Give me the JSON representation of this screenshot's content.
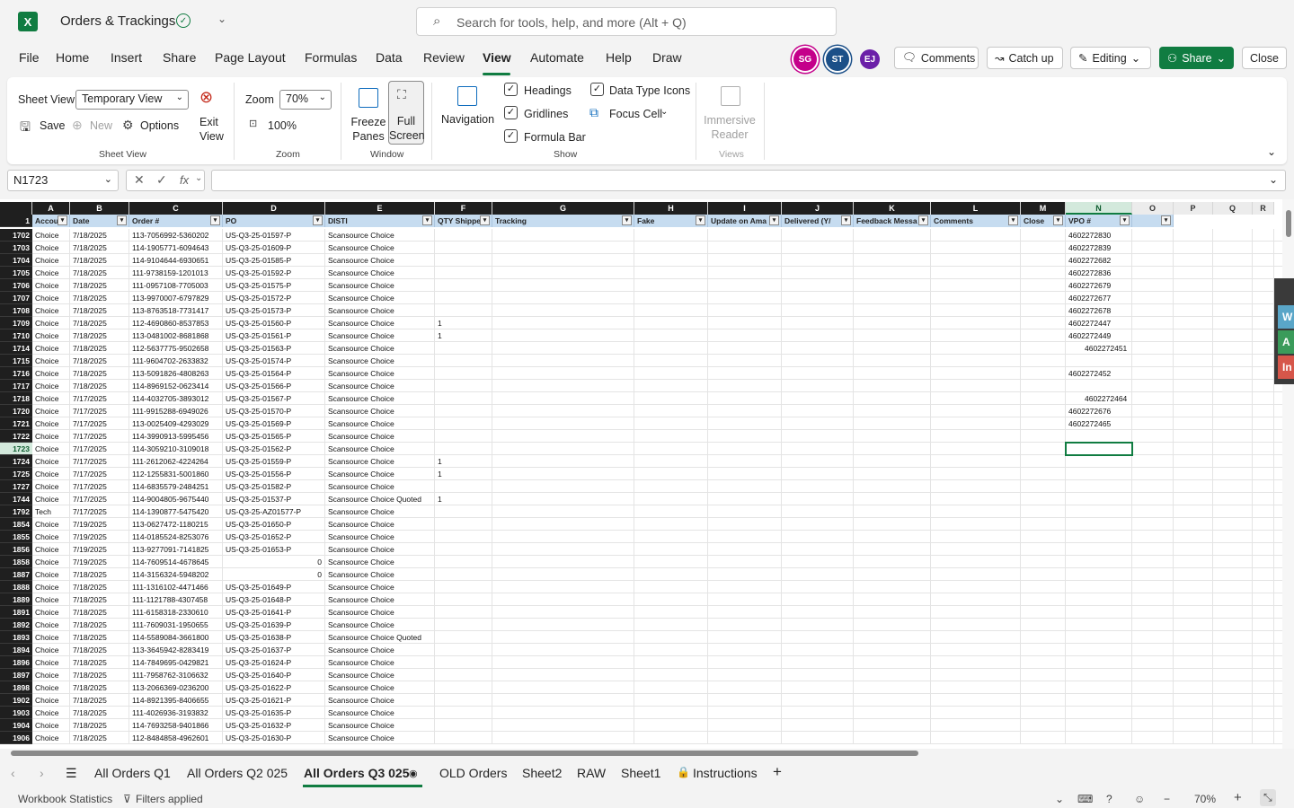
{
  "titlebar": {
    "logo": "X",
    "doc_title": "Orders & Trackings",
    "search_placeholder": "Search for tools, help, and more (Alt + Q)"
  },
  "menu": [
    "File",
    "Home",
    "Insert",
    "Share",
    "Page Layout",
    "Formulas",
    "Data",
    "Review",
    "View",
    "Automate",
    "Help",
    "Draw"
  ],
  "active_menu": "View",
  "avatars": [
    {
      "initials": "SG",
      "color": "#c4008a"
    },
    {
      "initials": "ST",
      "color": "#1b4f88"
    },
    {
      "initials": "EJ",
      "color": "#6b1fa8"
    }
  ],
  "top_buttons": {
    "comments": "Comments",
    "catchup": "Catch up",
    "editing": "Editing",
    "share": "Share",
    "close": "Close"
  },
  "ribbon": {
    "sheet_view_label": "Sheet View",
    "sheet_view_select": "Temporary View",
    "save": "Save",
    "new": "New",
    "options": "Options",
    "exit_view": "Exit View",
    "group_sheet_view": "Sheet View",
    "zoom_label": "Zoom",
    "zoom_value": "70%",
    "zoom_100": "100%",
    "group_zoom": "Zoom",
    "freeze_panes": "Freeze Panes",
    "full_screen": "Full Screen",
    "group_window": "Window",
    "navigation": "Navigation",
    "headings": "Headings",
    "gridlines": "Gridlines",
    "formula_bar": "Formula Bar",
    "data_type_icons": "Data Type Icons",
    "focus_cell": "Focus Cell",
    "group_show": "Show",
    "immersive_reader": "Immersive Reader",
    "group_views": "Views"
  },
  "formula_bar": {
    "name_box": "N1723",
    "fx": "fx",
    "value": ""
  },
  "columns": [
    "A",
    "B",
    "C",
    "D",
    "E",
    "F",
    "G",
    "H",
    "I",
    "J",
    "K",
    "L",
    "M",
    "N",
    "O",
    "P",
    "Q",
    "R"
  ],
  "headers": [
    "Accou",
    "Date",
    "Order #",
    "PO",
    "DISTI",
    "QTY Shippe",
    "Tracking",
    "Fake",
    "Update on Ama",
    "Delivered (Y/",
    "Feedback Messa",
    "Comments",
    "Close",
    "VPO #",
    ""
  ],
  "header_row_num": "1",
  "rows": [
    [
      "1702",
      "Choice",
      "7/18/2025",
      "113-7056992-5360202",
      "US-Q3-25-01597-P",
      "Scansource Choice",
      "",
      "4602272830"
    ],
    [
      "1703",
      "Choice",
      "7/18/2025",
      "114-1905771-6094643",
      "US-Q3-25-01609-P",
      "Scansource Choice",
      "",
      "4602272839"
    ],
    [
      "1704",
      "Choice",
      "7/18/2025",
      "114-9104644-6930651",
      "US-Q3-25-01585-P",
      "Scansource Choice",
      "",
      "4602272682"
    ],
    [
      "1705",
      "Choice",
      "7/18/2025",
      "111-9738159-1201013",
      "US-Q3-25-01592-P",
      "Scansource Choice",
      "",
      "4602272836"
    ],
    [
      "1706",
      "Choice",
      "7/18/2025",
      "111-0957108-7705003",
      "US-Q3-25-01575-P",
      "Scansource Choice",
      "",
      "4602272679"
    ],
    [
      "1707",
      "Choice",
      "7/18/2025",
      "113-9970007-6797829",
      "US-Q3-25-01572-P",
      "Scansource Choice",
      "",
      "4602272677"
    ],
    [
      "1708",
      "Choice",
      "7/18/2025",
      "113-8763518-7731417",
      "US-Q3-25-01573-P",
      "Scansource Choice",
      "",
      "4602272678"
    ],
    [
      "1709",
      "Choice",
      "7/18/2025",
      "112-4690860-8537853",
      "US-Q3-25-01560-P",
      "Scansource Choice",
      "1",
      "4602272447"
    ],
    [
      "1710",
      "Choice",
      "7/18/2025",
      "113-0481002-8681868",
      "US-Q3-25-01561-P",
      "Scansource Choice",
      "1",
      "4602272449"
    ],
    [
      "1714",
      "Choice",
      "7/18/2025",
      "112-5637775-9502658",
      "US-Q3-25-01563-P",
      "Scansource Choice",
      "",
      "4602272451"
    ],
    [
      "1715",
      "Choice",
      "7/18/2025",
      "111-9604702-2633832",
      "US-Q3-25-01574-P",
      "Scansource Choice",
      "",
      ""
    ],
    [
      "1716",
      "Choice",
      "7/18/2025",
      "113-5091826-4808263",
      "US-Q3-25-01564-P",
      "Scansource Choice",
      "",
      "4602272452"
    ],
    [
      "1717",
      "Choice",
      "7/18/2025",
      "114-8969152-0623414",
      "US-Q3-25-01566-P",
      "Scansource Choice",
      "",
      ""
    ],
    [
      "1718",
      "Choice",
      "7/17/2025",
      "114-4032705-3893012",
      "US-Q3-25-01567-P",
      "Scansource Choice",
      "",
      "4602272464"
    ],
    [
      "1720",
      "Choice",
      "7/17/2025",
      "111-9915288-6949026",
      "US-Q3-25-01570-P",
      "Scansource Choice",
      "",
      "4602272676"
    ],
    [
      "1721",
      "Choice",
      "7/17/2025",
      "113-0025409-4293029",
      "US-Q3-25-01569-P",
      "Scansource Choice",
      "",
      "4602272465"
    ],
    [
      "1722",
      "Choice",
      "7/17/2025",
      "114-3990913-5995456",
      "US-Q3-25-01565-P",
      "Scansource Choice",
      "",
      ""
    ],
    [
      "1723",
      "Choice",
      "7/17/2025",
      "114-3059210-3109018",
      "US-Q3-25-01562-P",
      "Scansource Choice",
      "",
      ""
    ],
    [
      "1724",
      "Choice",
      "7/17/2025",
      "111-2612062-4224264",
      "US-Q3-25-01559-P",
      "Scansource Choice",
      "1",
      ""
    ],
    [
      "1725",
      "Choice",
      "7/17/2025",
      "112-1255831-5001860",
      "US-Q3-25-01556-P",
      "Scansource Choice",
      "1",
      ""
    ],
    [
      "1727",
      "Choice",
      "7/17/2025",
      "114-6835579-2484251",
      "US-Q3-25-01582-P",
      "Scansource Choice",
      "",
      ""
    ],
    [
      "1744",
      "Choice",
      "7/17/2025",
      "114-9004805-9675440",
      "US-Q3-25-01537-P",
      "Scansource Choice Quoted",
      "1",
      ""
    ],
    [
      "1792",
      "Tech",
      "7/17/2025",
      "114-1390877-5475420",
      "US-Q3-25-AZ01577-P",
      "Scansource Choice",
      "",
      ""
    ],
    [
      "1854",
      "Choice",
      "7/19/2025",
      "113-0627472-1180215",
      "US-Q3-25-01650-P",
      "Scansource Choice",
      "",
      ""
    ],
    [
      "1855",
      "Choice",
      "7/19/2025",
      "114-0185524-8253076",
      "US-Q3-25-01652-P",
      "Scansource Choice",
      "",
      ""
    ],
    [
      "1856",
      "Choice",
      "7/19/2025",
      "113-9277091-7141825",
      "US-Q3-25-01653-P",
      "Scansource Choice",
      "",
      ""
    ],
    [
      "1858",
      "Choice",
      "7/19/2025",
      "114-7609514-4678645",
      "0",
      "Scansource Choice",
      "",
      ""
    ],
    [
      "1887",
      "Choice",
      "7/18/2025",
      "114-3156324-5948202",
      "0",
      "Scansource Choice",
      "",
      ""
    ],
    [
      "1888",
      "Choice",
      "7/18/2025",
      "111-1316102-4471466",
      "US-Q3-25-01649-P",
      "Scansource Choice",
      "",
      ""
    ],
    [
      "1889",
      "Choice",
      "7/18/2025",
      "111-1121788-4307458",
      "US-Q3-25-01648-P",
      "Scansource Choice",
      "",
      ""
    ],
    [
      "1891",
      "Choice",
      "7/18/2025",
      "111-6158318-2330610",
      "US-Q3-25-01641-P",
      "Scansource Choice",
      "",
      ""
    ],
    [
      "1892",
      "Choice",
      "7/18/2025",
      "111-7609031-1950655",
      "US-Q3-25-01639-P",
      "Scansource Choice",
      "",
      ""
    ],
    [
      "1893",
      "Choice",
      "7/18/2025",
      "114-5589084-3661800",
      "US-Q3-25-01638-P",
      "Scansource Choice Quoted",
      "",
      ""
    ],
    [
      "1894",
      "Choice",
      "7/18/2025",
      "113-3645942-8283419",
      "US-Q3-25-01637-P",
      "Scansource Choice",
      "",
      ""
    ],
    [
      "1896",
      "Choice",
      "7/18/2025",
      "114-7849695-0429821",
      "US-Q3-25-01624-P",
      "Scansource Choice",
      "",
      ""
    ],
    [
      "1897",
      "Choice",
      "7/18/2025",
      "111-7958762-3106632",
      "US-Q3-25-01640-P",
      "Scansource Choice",
      "",
      ""
    ],
    [
      "1898",
      "Choice",
      "7/18/2025",
      "113-2066369-0236200",
      "US-Q3-25-01622-P",
      "Scansource Choice",
      "",
      ""
    ],
    [
      "1902",
      "Choice",
      "7/18/2025",
      "114-8921395-8406655",
      "US-Q3-25-01621-P",
      "Scansource Choice",
      "",
      ""
    ],
    [
      "1903",
      "Choice",
      "7/18/2025",
      "111-4026936-3193832",
      "US-Q3-25-01635-P",
      "Scansource Choice",
      "",
      ""
    ],
    [
      "1904",
      "Choice",
      "7/18/2025",
      "114-7693258-9401866",
      "US-Q3-25-01632-P",
      "Scansource Choice",
      "",
      ""
    ],
    [
      "1906",
      "Choice",
      "7/18/2025",
      "112-8484858-4962601",
      "US-Q3-25-01630-P",
      "Scansource Choice",
      "",
      ""
    ]
  ],
  "selected_row": "1723",
  "side_tabs": [
    "W",
    "A",
    "In"
  ],
  "sheet_tabs": [
    "All Orders Q1",
    "All Orders Q2 025",
    "All Orders Q3 025",
    "OLD Orders",
    "Sheet2",
    "RAW",
    "Sheet1",
    "Instructions"
  ],
  "active_sheet": "All Orders Q3 025",
  "statusbar": {
    "workbook_stats": "Workbook Statistics",
    "filters": "Filters applied",
    "zoom": "70%"
  }
}
